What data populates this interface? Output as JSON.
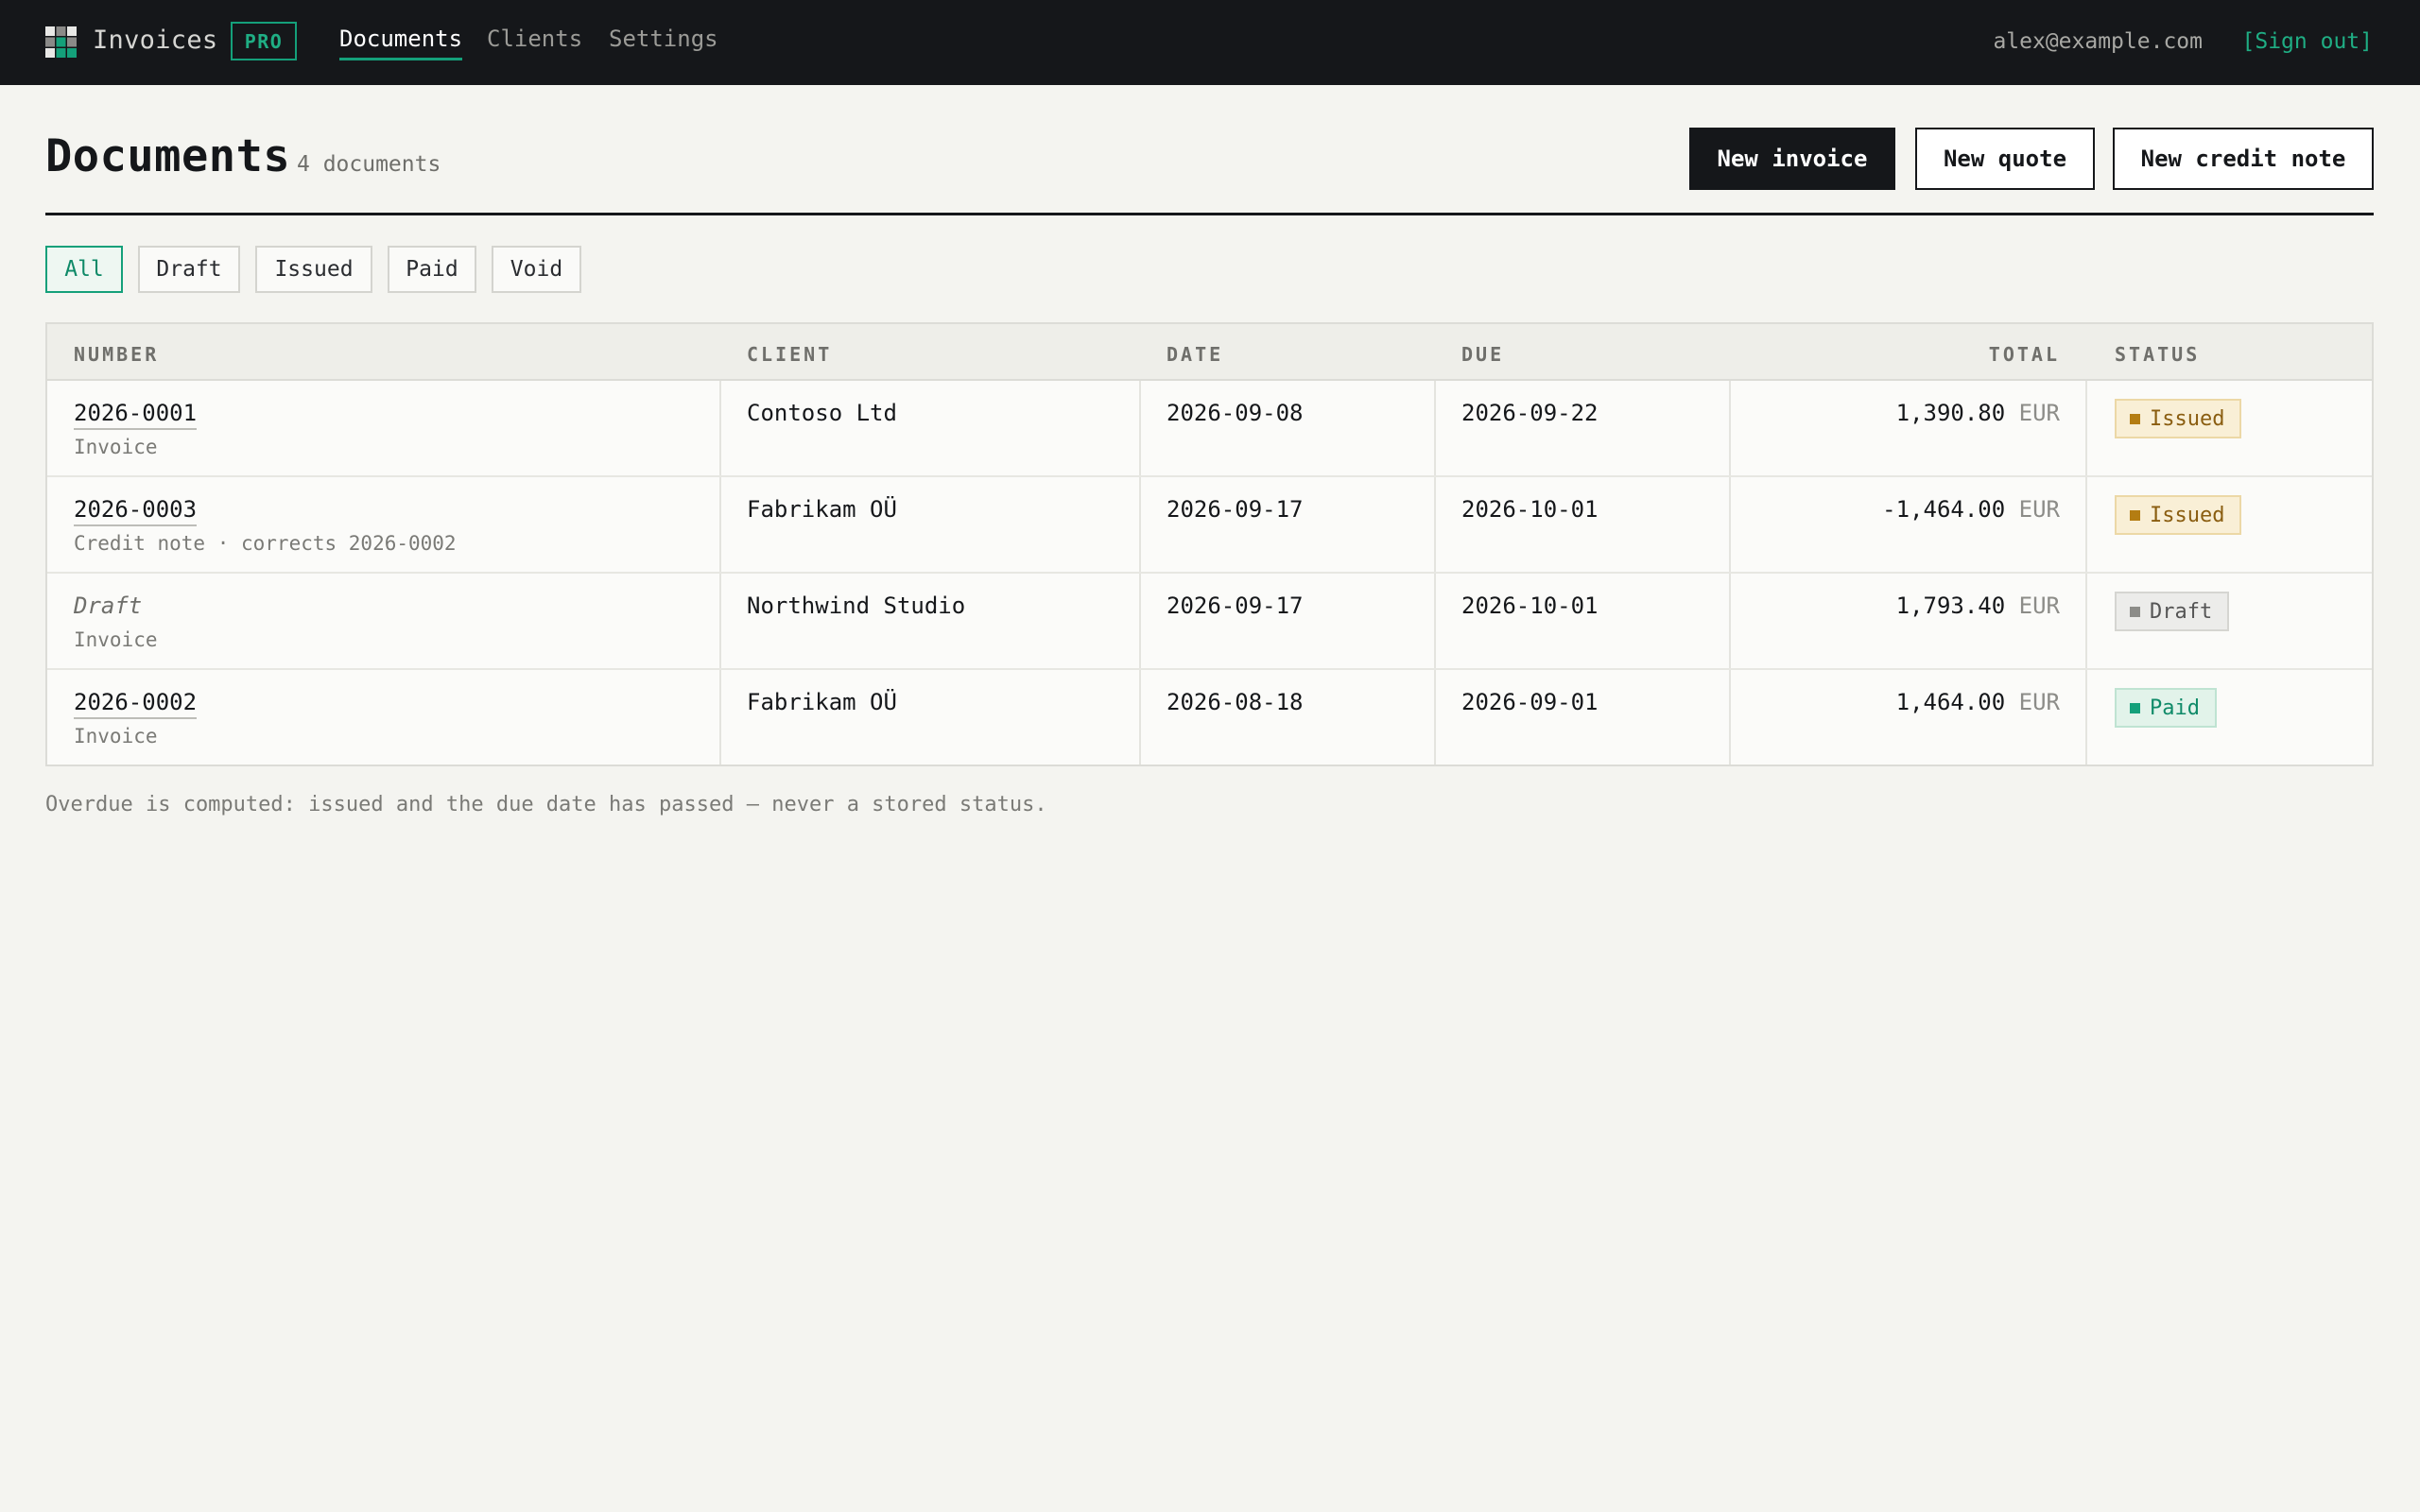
{
  "nav": {
    "brand": "Invoices",
    "badge": "PRO",
    "links": [
      "Documents",
      "Clients",
      "Settings"
    ],
    "user_email": "alex@example.com",
    "sign_out": "[Sign out]"
  },
  "header": {
    "title": "Documents",
    "count": "4 documents",
    "buttons": {
      "new_invoice": "New invoice",
      "new_quote": "New quote",
      "new_credit_note": "New credit note"
    }
  },
  "filters": [
    "All",
    "Draft",
    "Issued",
    "Paid",
    "Void"
  ],
  "active_filter": "All",
  "table": {
    "headers": [
      "NUMBER",
      "CLIENT",
      "DATE",
      "DUE",
      "TOTAL",
      "STATUS"
    ],
    "rows": [
      {
        "number": "2026-0001",
        "type": "Invoice",
        "client": "Contoso Ltd",
        "date": "2026-09-08",
        "due": "2026-09-22",
        "total": "1,390.80",
        "currency": "EUR",
        "status": "Issued",
        "status_kind": "issued"
      },
      {
        "number": "2026-0003",
        "type": "Credit note · corrects 2026-0002",
        "client": "Fabrikam OÜ",
        "date": "2026-09-17",
        "due": "2026-10-01",
        "total": "-1,464.00",
        "currency": "EUR",
        "status": "Issued",
        "status_kind": "issued"
      },
      {
        "number": "Draft",
        "type": "Invoice",
        "client": "Northwind Studio",
        "date": "2026-09-17",
        "due": "2026-10-01",
        "total": "1,793.40",
        "currency": "EUR",
        "status": "Draft",
        "status_kind": "draft"
      },
      {
        "number": "2026-0002",
        "type": "Invoice",
        "client": "Fabrikam OÜ",
        "date": "2026-08-18",
        "due": "2026-09-01",
        "total": "1,464.00",
        "currency": "EUR",
        "status": "Paid",
        "status_kind": "paid"
      }
    ]
  },
  "footnote": "Overdue is computed: issued and the due date has passed — never a stored status.",
  "colors": {
    "accent": "#14a07a",
    "topbar": "#15171a",
    "background": "#f4f4f0",
    "issued": "#b47d12",
    "paid": "#14a07a",
    "draft": "#8c8c88"
  },
  "icons": {
    "logo": "grid-logo-icon"
  }
}
